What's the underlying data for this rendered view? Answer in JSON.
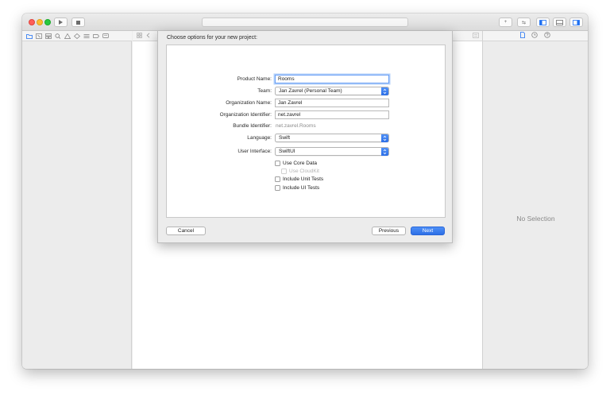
{
  "window": {
    "toolbar": {
      "run_icon": "play-icon",
      "stop_icon": "stop-icon",
      "add_label": "+",
      "back_forward_label": "⇆"
    },
    "navigator_icons": [
      "folder-icon",
      "source-control-icon",
      "hierarchy-icon",
      "search-icon",
      "warning-icon",
      "test-icon",
      "debug-icon",
      "breakpoint-icon",
      "report-icon"
    ],
    "inspector_icons": [
      "file-inspector-icon",
      "history-icon",
      "help-icon"
    ]
  },
  "dialog": {
    "title": "Choose options for your new project:",
    "fields": {
      "product_name": {
        "label": "Product Name:",
        "value": "Rooms"
      },
      "team": {
        "label": "Team:",
        "value": "Jan Zavrel (Personal Team)"
      },
      "organization_name": {
        "label": "Organization Name:",
        "value": "Jan Zavrel"
      },
      "organization_identifier": {
        "label": "Organization Identifier:",
        "value": "net.zavrel"
      },
      "bundle_identifier": {
        "label": "Bundle Identifier:",
        "value": "net.zavrel.Rooms"
      },
      "language": {
        "label": "Language:",
        "value": "Swift"
      },
      "user_interface": {
        "label": "User Interface:",
        "value": "SwiftUI"
      }
    },
    "checkboxes": {
      "use_core_data": {
        "label": "Use Core Data",
        "checked": false,
        "enabled": true
      },
      "use_cloudkit": {
        "label": "Use CloudKit",
        "checked": false,
        "enabled": false
      },
      "include_unit_tests": {
        "label": "Include Unit Tests",
        "checked": false,
        "enabled": true
      },
      "include_ui_tests": {
        "label": "Include UI Tests",
        "checked": false,
        "enabled": true
      }
    },
    "buttons": {
      "cancel": "Cancel",
      "previous": "Previous",
      "next": "Next"
    }
  },
  "inspector": {
    "empty_text": "No Selection"
  },
  "colors": {
    "accent": "#2d6fe6",
    "close": "#fe5f57",
    "minimize": "#febc2e",
    "maximize": "#28c840"
  }
}
